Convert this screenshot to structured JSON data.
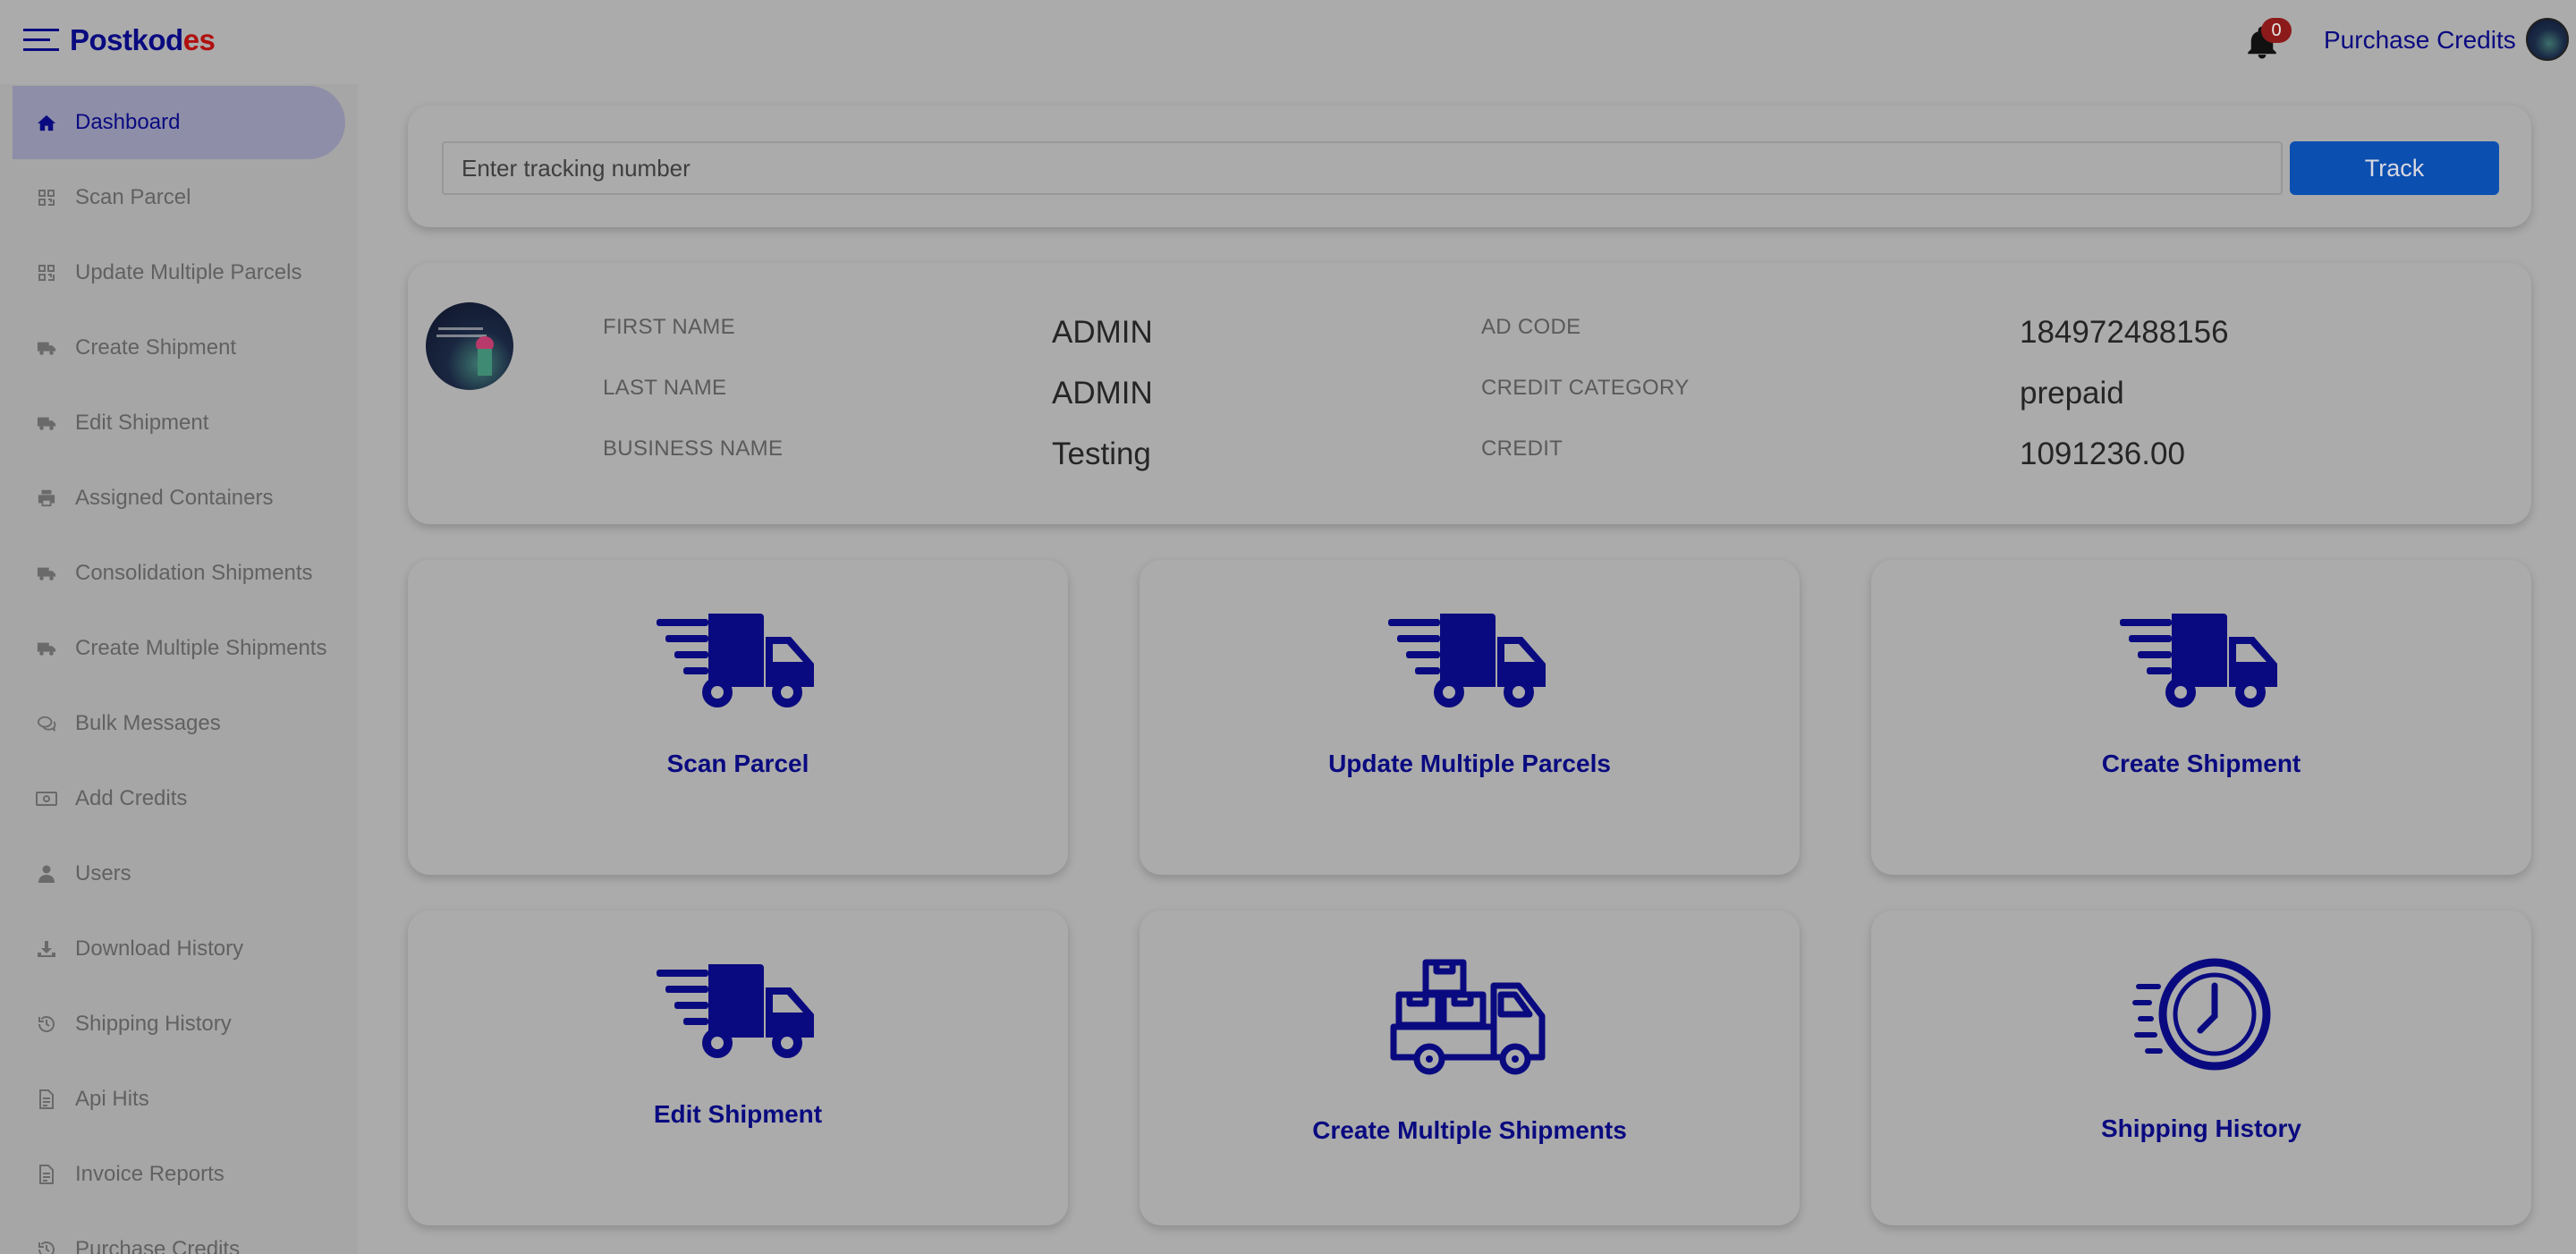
{
  "brand": {
    "part1": "Postkod",
    "part2": "es"
  },
  "header": {
    "notifications_count": "0",
    "purchase_credits": "Purchase Credits"
  },
  "sidebar": {
    "items": [
      {
        "label": "Dashboard",
        "icon": "home-icon"
      },
      {
        "label": "Scan Parcel",
        "icon": "qr-icon"
      },
      {
        "label": "Update Multiple Parcels",
        "icon": "qr-icon"
      },
      {
        "label": "Create Shipment",
        "icon": "truck-icon"
      },
      {
        "label": "Edit Shipment",
        "icon": "truck-icon"
      },
      {
        "label": "Assigned Containers",
        "icon": "printer-icon"
      },
      {
        "label": "Consolidation Shipments",
        "icon": "truck-icon"
      },
      {
        "label": "Create Multiple Shipments",
        "icon": "truck-icon"
      },
      {
        "label": "Bulk Messages",
        "icon": "chat-icon"
      },
      {
        "label": "Add Credits",
        "icon": "money-icon"
      },
      {
        "label": "Users",
        "icon": "user-icon"
      },
      {
        "label": "Download History",
        "icon": "download-icon"
      },
      {
        "label": "Shipping History",
        "icon": "history-icon"
      },
      {
        "label": "Api Hits",
        "icon": "document-icon"
      },
      {
        "label": "Invoice Reports",
        "icon": "document-icon"
      },
      {
        "label": "Purchase Credits",
        "icon": "history-icon"
      }
    ]
  },
  "tracking": {
    "placeholder": "Enter tracking number",
    "button": "Track"
  },
  "profile": {
    "first_name_label": "FIRST NAME",
    "first_name": "ADMIN",
    "last_name_label": "LAST NAME",
    "last_name": "ADMIN",
    "business_name_label": "BUSINESS NAME",
    "business_name": "Testing",
    "ad_code_label": "AD CODE",
    "ad_code": "184972488156",
    "credit_category_label": "CREDIT CATEGORY",
    "credit_category": "prepaid",
    "credit_label": "CREDIT",
    "credit": "1091236.00"
  },
  "tiles": [
    {
      "label": "Scan Parcel",
      "icon": "fast-truck-icon"
    },
    {
      "label": "Update Multiple Parcels",
      "icon": "fast-truck-icon"
    },
    {
      "label": "Create Shipment",
      "icon": "fast-truck-icon"
    },
    {
      "label": "Edit Shipment",
      "icon": "fast-truck-icon"
    },
    {
      "label": "Create Multiple Shipments",
      "icon": "box-truck-icon"
    },
    {
      "label": "Shipping History",
      "icon": "fast-clock-icon"
    }
  ],
  "colors": {
    "brand_blue": "#0a0a80",
    "brand_red": "#b01010",
    "track_button": "#0b4fb0",
    "overlay_bg": "#ababab"
  }
}
